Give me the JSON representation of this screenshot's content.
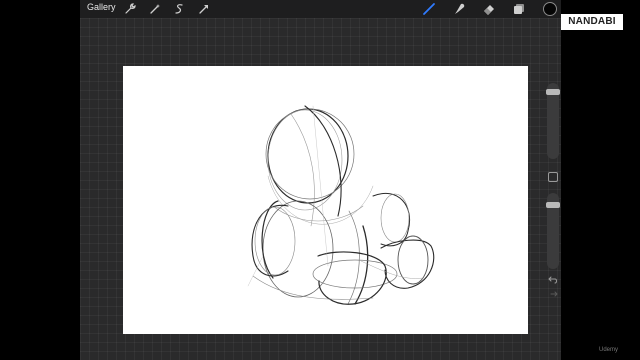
{
  "toolbar": {
    "gallery_label": "Gallery",
    "left_tools": [
      "wrench-icon",
      "magic-wand-icon",
      "selection-icon",
      "transform-arrow-icon"
    ],
    "right_tools": [
      "brush-icon",
      "smudge-icon",
      "eraser-icon",
      "layers-icon"
    ],
    "active_tool": "brush-icon",
    "accent_color": "#2f7bff",
    "current_color": "#050505"
  },
  "sidebar": {
    "brush_size_level": 0.92,
    "opacity_level": 0.88,
    "undo_icon": "undo-icon",
    "redo_icon": "redo-icon"
  },
  "watermark": "NANDABI",
  "udemy_label": "Udemy"
}
